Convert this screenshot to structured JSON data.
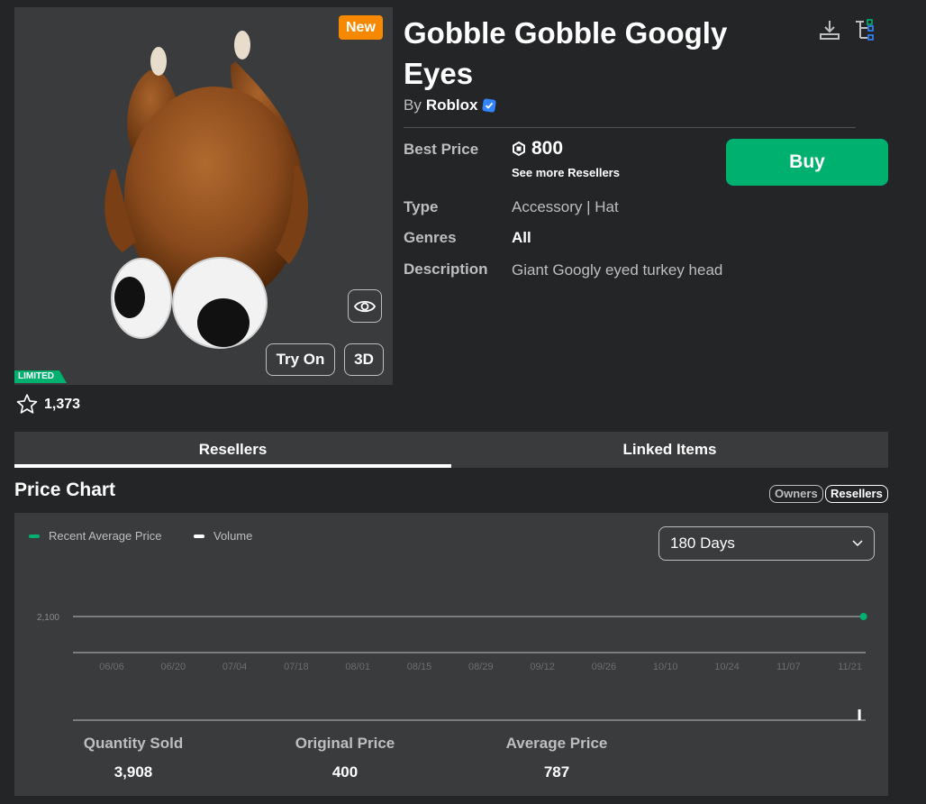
{
  "item": {
    "new_badge": "New",
    "title": "Gobble Gobble Googly Eyes",
    "by_prefix": "By",
    "creator": "Roblox",
    "limited_badge": "LIMITED",
    "favorites": "1,373",
    "buttons": {
      "try_on": "Try On",
      "view_3d": "3D",
      "buy": "Buy"
    }
  },
  "details": {
    "best_price_label": "Best Price",
    "best_price": "800",
    "see_more": "See more Resellers",
    "type_label": "Type",
    "type_value": "Accessory | Hat",
    "genres_label": "Genres",
    "genres_value": "All",
    "description_label": "Description",
    "description_value": "Giant Googly eyed turkey head"
  },
  "tabs": [
    {
      "label": "Resellers",
      "active": true
    },
    {
      "label": "Linked Items",
      "active": false
    }
  ],
  "price_chart": {
    "title": "Price Chart",
    "toggle_owners": "Owners",
    "toggle_resellers": "Resellers",
    "legend_avg": "Recent Average Price",
    "legend_volume": "Volume",
    "range_select": "180 Days"
  },
  "stats": {
    "quantity_sold_label": "Quantity Sold",
    "quantity_sold": "3,908",
    "original_price_label": "Original Price",
    "original_price": "400",
    "average_price_label": "Average Price",
    "average_price": "787"
  },
  "colors": {
    "accent_green": "#00b06f",
    "new_badge": "#f68802",
    "verified": "#3385ff"
  },
  "chart_data": {
    "type": "line",
    "x_ticks": [
      "06/06",
      "06/20",
      "07/04",
      "07/18",
      "08/01",
      "08/15",
      "08/29",
      "09/12",
      "09/26",
      "10/10",
      "10/24",
      "11/07",
      "11/21"
    ],
    "y_ticks": [
      "2,100"
    ],
    "series": [
      {
        "name": "Recent Average Price",
        "color": "#00b06f",
        "points": [
          {
            "x": "11/21",
            "y": 2100
          }
        ]
      },
      {
        "name": "Volume",
        "color": "#ffffff",
        "points": [
          {
            "x": "11/21",
            "y": 1
          }
        ]
      }
    ],
    "ylim": [
      0,
      2100
    ],
    "legend": "top-left"
  }
}
